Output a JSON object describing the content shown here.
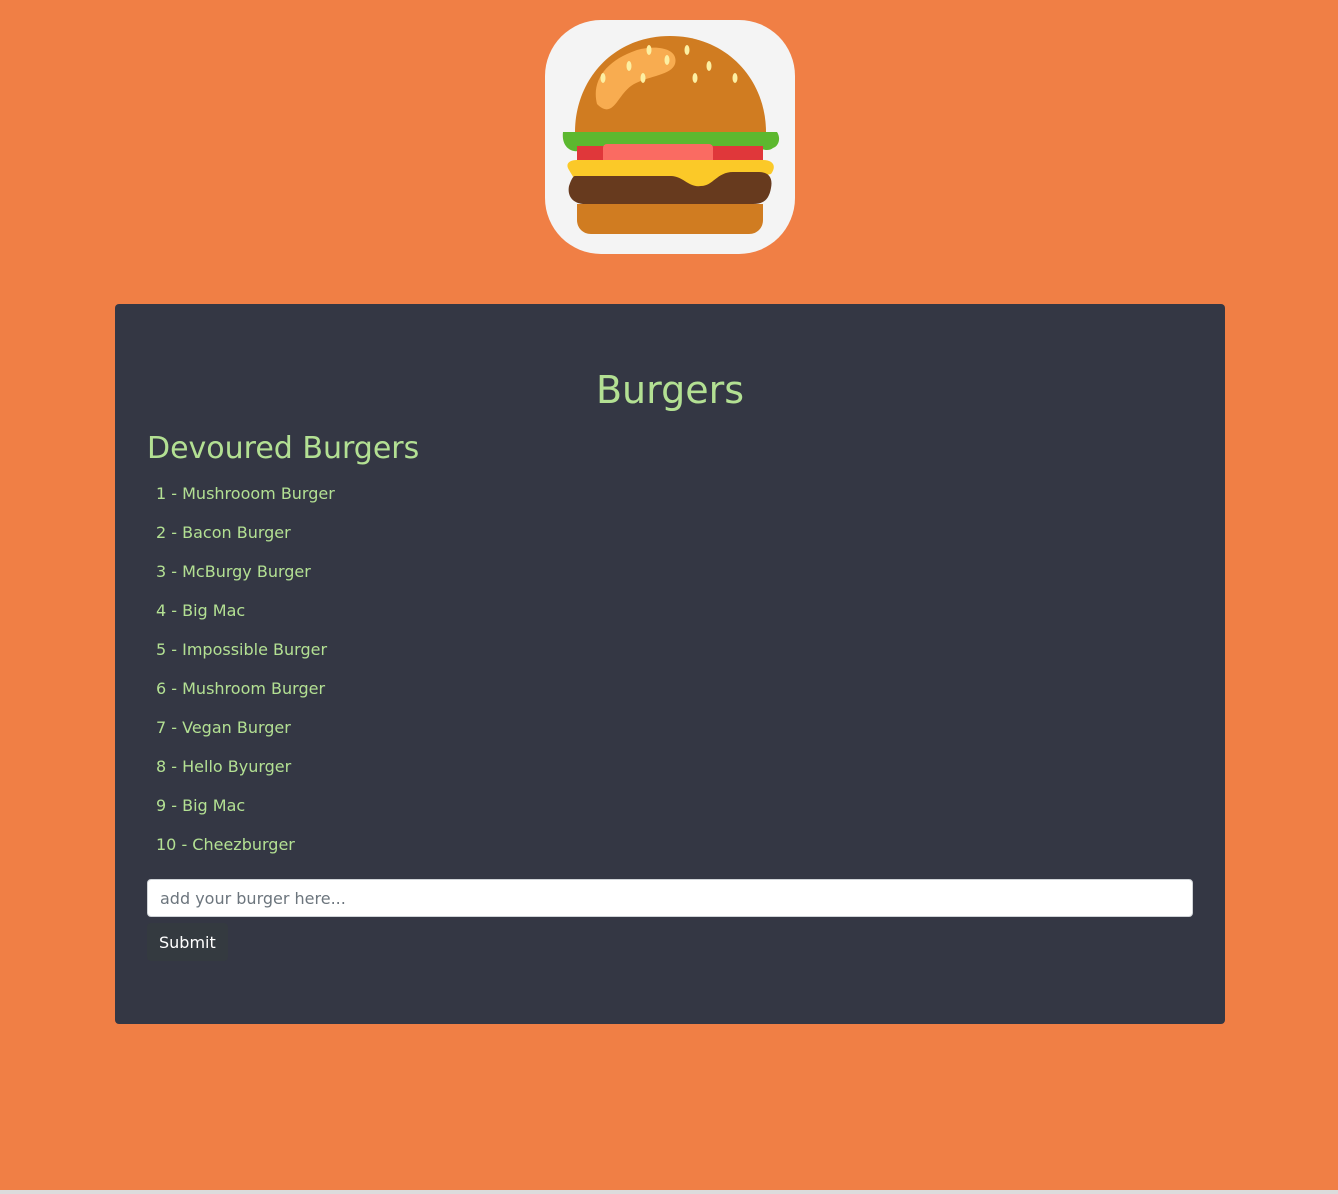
{
  "logo": {
    "icon": "burger-icon"
  },
  "main": {
    "title": "Burgers",
    "devoured_heading": "Devoured Burgers",
    "burgers": [
      "1 - Mushrooom Burger",
      "2 - Bacon Burger",
      "3 - McBurgy Burger",
      "4 - Big Mac",
      "5 - Impossible Burger",
      "6 - Mushroom Burger",
      "7 - Vegan Burger",
      "8 - Hello Byurger",
      "9 - Big Mac",
      "10 - Cheezburger"
    ]
  },
  "form": {
    "placeholder": "add your burger here...",
    "value": "",
    "submit_label": "Submit"
  },
  "colors": {
    "background": "#f07f45",
    "panel": "#343744",
    "accent_text": "#b3e093"
  }
}
